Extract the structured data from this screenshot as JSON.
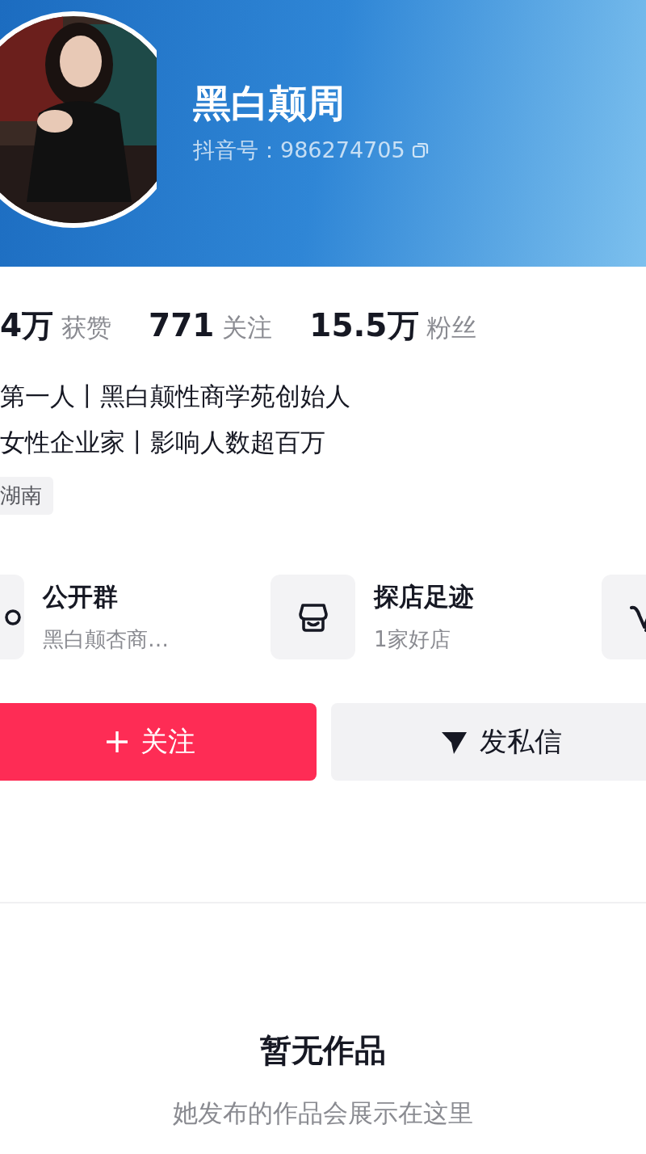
{
  "profile": {
    "name": "黑白颠周",
    "account": "抖音号：986274705"
  },
  "stats": [
    "**4万** 获赞",
    "**771** 关注",
    "**15.5万** 粉丝"
  ],
  "bio": [
    "第一人丨黑白颠性商学苑创始人",
    "女性企业家丨影响人数超百万"
  ],
  "tags": [
    "湖南"
  ],
  "shortcuts": [
    {
      "kind": "group",
      "title": "公开群",
      "subtitle": "黑白颠杏商…"
    },
    {
      "kind": "store",
      "title": "探店足迹",
      "subtitle": "1家好店"
    },
    {
      "kind": "v"
    }
  ],
  "actions": [
    {
      "kind": "follow",
      "label": "关注"
    },
    {
      "kind": "message",
      "label": "发私信"
    }
  ],
  "empty": {
    "title": "暂无作品",
    "subtitle": "她发布的作品会展示在这里"
  }
}
